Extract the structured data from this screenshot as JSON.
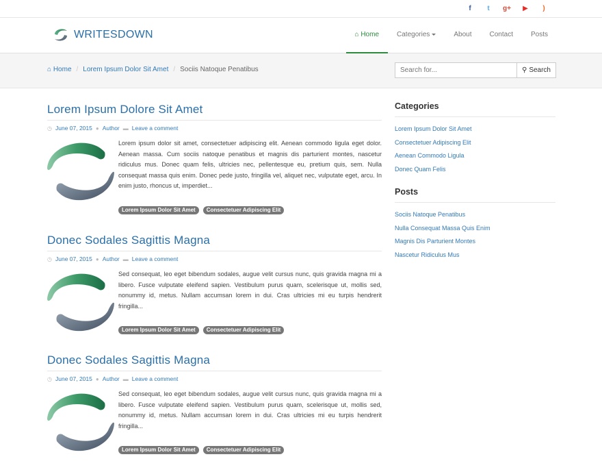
{
  "social": [
    {
      "icon": "facebook-icon",
      "glyph": "f",
      "color": "#3b5998"
    },
    {
      "icon": "twitter-icon",
      "glyph": "t",
      "color": "#55acee"
    },
    {
      "icon": "google-plus-icon",
      "glyph": "g+",
      "color": "#dd4b39"
    },
    {
      "icon": "youtube-icon",
      "glyph": "▶",
      "color": "#e52d27"
    },
    {
      "icon": "rss-icon",
      "glyph": ")",
      "color": "#f26522"
    }
  ],
  "brand": {
    "name": "WRITESDOWN"
  },
  "nav": {
    "home": "Home",
    "categories": "Categories",
    "about": "About",
    "contact": "Contact",
    "posts": "Posts"
  },
  "breadcrumb": {
    "home": "Home",
    "category": "Lorem Ipsum Dolor Sit Amet",
    "current": "Sociis Natoque Penatibus"
  },
  "search": {
    "placeholder": "Search for...",
    "button": "Search"
  },
  "posts": [
    {
      "title": "Lorem Ipsum Dolore Sit Amet",
      "date": "June 07, 2015",
      "author": "Author",
      "comment": "Leave a comment",
      "excerpt": "Lorem ipsum dolor sit amet, consectetuer adipiscing elit. Aenean commodo ligula eget dolor. Aenean massa. Cum sociis natoque penatibus et magnis dis parturient montes, nascetur ridiculus mus. Donec quam felis, ultricies nec, pellentesque eu, pretium quis, sem. Nulla consequat massa quis enim. Donec pede justo, fringilla vel, aliquet nec, vulputate eget, arcu. In enim justo, rhoncus ut, imperdiet...",
      "tags": [
        "Lorem Ipsum Dolor Sit Amet",
        "Consectetuer Adipiscing Elit"
      ]
    },
    {
      "title": "Donec Sodales Sagittis Magna",
      "date": "June 07, 2015",
      "author": "Author",
      "comment": "Leave a comment",
      "excerpt": "Sed consequat, leo eget bibendum sodales, augue velit cursus nunc, quis gravida magna mi a libero. Fusce vulputate eleifend sapien. Vestibulum purus quam, scelerisque ut, mollis sed, nonummy id, metus. Nullam accumsan lorem in dui. Cras ultricies mi eu turpis hendrerit fringilla...",
      "tags": [
        "Lorem Ipsum Dolor Sit Amet",
        "Consectetuer Adipiscing Elit"
      ]
    },
    {
      "title": "Donec Sodales Sagittis Magna",
      "date": "June 07, 2015",
      "author": "Author",
      "comment": "Leave a comment",
      "excerpt": "Sed consequat, leo eget bibendum sodales, augue velit cursus nunc, quis gravida magna mi a libero. Fusce vulputate eleifend sapien. Vestibulum purus quam, scelerisque ut, mollis sed, nonummy id, metus. Nullam accumsan lorem in dui. Cras ultricies mi eu turpis hendrerit fringilla...",
      "tags": [
        "Lorem Ipsum Dolor Sit Amet",
        "Consectetuer Adipiscing Elit"
      ]
    }
  ],
  "sidebar": {
    "categories_title": "Categories",
    "categories": [
      "Lorem Ipsum Dolor Sit Amet",
      "Consectetuer Adipiscing Elit",
      "Aenean Commodo Ligula",
      "Donec Quam Felis"
    ],
    "posts_title": "Posts",
    "posts": [
      "Sociis Natoque Penatibus",
      "Nulla Consequat Massa Quis Enim",
      "Magnis Dis Parturient Montes",
      "Nascetur Ridiculus Mus"
    ]
  }
}
